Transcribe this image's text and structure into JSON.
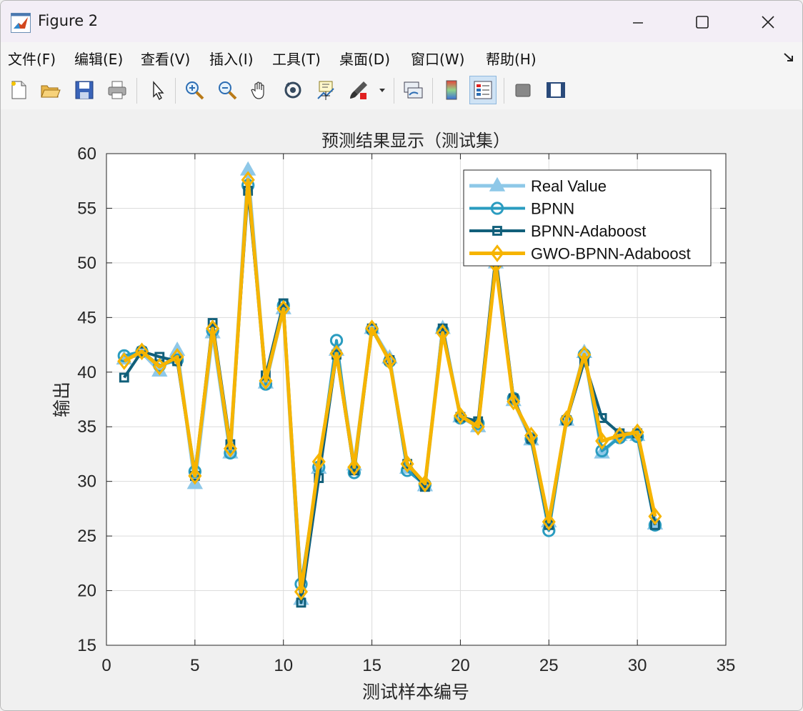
{
  "window": {
    "title": "Figure 2"
  },
  "menu": [
    "文件(F)",
    "编辑(E)",
    "查看(V)",
    "插入(I)",
    "工具(T)",
    "桌面(D)",
    "窗口(W)",
    "帮助(H)"
  ],
  "toolbar": [
    "new-figure-icon",
    "open-file-icon",
    "save-icon",
    "print-icon",
    "pointer-icon",
    "zoom-in-icon",
    "zoom-out-icon",
    "pan-hand-icon",
    "rotate-3d-icon",
    "data-cursor-icon",
    "brush-icon",
    "link-plot-icon",
    "colorbar-icon",
    "legend-icon",
    "hide-plot-tools-icon",
    "show-plot-tools-icon"
  ],
  "colors": {
    "real": "#8ec8e8",
    "bpnn": "#2a9cc0",
    "bpnn_ada": "#115f7a",
    "gwo": "#f6b400"
  },
  "chart_data": {
    "type": "line",
    "title": "预测结果显示（测试集）",
    "xlabel": "测试样本编号",
    "ylabel": "输出",
    "xlim": [
      0,
      35
    ],
    "ylim": [
      15,
      60
    ],
    "xticks": [
      0,
      5,
      10,
      15,
      20,
      25,
      30,
      35
    ],
    "yticks": [
      15,
      20,
      25,
      30,
      35,
      40,
      45,
      50,
      55,
      60
    ],
    "grid": true,
    "legend_position": "top-right",
    "x": [
      1,
      2,
      3,
      4,
      5,
      6,
      7,
      8,
      9,
      10,
      11,
      12,
      13,
      14,
      15,
      16,
      17,
      18,
      19,
      20,
      21,
      22,
      23,
      24,
      25,
      26,
      27,
      28,
      29,
      30,
      31
    ],
    "series": [
      {
        "name": "Real Value",
        "marker": "triangle",
        "color_key": "real",
        "values": [
          41.2,
          41.8,
          40.1,
          42.0,
          29.8,
          43.6,
          32.6,
          58.5,
          39.0,
          45.8,
          19.2,
          31.2,
          42.0,
          31.5,
          44.0,
          41.3,
          31.2,
          29.6,
          44.0,
          35.9,
          35.0,
          50.0,
          37.4,
          33.8,
          26.3,
          35.6,
          41.8,
          32.6,
          34.2,
          34.2,
          26.1
        ]
      },
      {
        "name": "BPNN",
        "marker": "circle",
        "color_key": "bpnn",
        "values": [
          41.5,
          41.9,
          40.6,
          41.1,
          30.9,
          43.8,
          32.6,
          57.1,
          38.9,
          46.1,
          20.6,
          31.3,
          42.9,
          30.8,
          43.9,
          41.0,
          31.0,
          29.7,
          43.8,
          35.8,
          35.3,
          50.0,
          37.6,
          33.9,
          25.5,
          35.6,
          41.6,
          32.8,
          34.0,
          34.1,
          26.0
        ]
      },
      {
        "name": "BPNN-Adaboost",
        "marker": "square",
        "color_key": "bpnn_ada",
        "values": [
          39.5,
          41.9,
          41.4,
          41.0,
          30.5,
          44.5,
          33.4,
          56.6,
          39.7,
          46.3,
          18.9,
          30.3,
          41.6,
          31.0,
          44.0,
          41.1,
          31.6,
          29.5,
          44.0,
          35.9,
          35.5,
          50.6,
          37.6,
          33.9,
          26.0,
          35.6,
          41.0,
          35.8,
          34.4,
          34.4,
          26.0
        ]
      },
      {
        "name": "GWO-BPNN-Adaboost",
        "marker": "diamond",
        "color_key": "gwo",
        "values": [
          41.0,
          41.9,
          40.5,
          41.4,
          30.5,
          44.0,
          33.0,
          57.6,
          39.2,
          45.8,
          19.9,
          31.8,
          41.7,
          31.3,
          44.0,
          41.0,
          31.6,
          29.8,
          43.6,
          36.0,
          35.0,
          49.8,
          37.3,
          34.2,
          26.3,
          35.7,
          41.6,
          33.7,
          34.2,
          34.5,
          26.8
        ]
      }
    ]
  }
}
